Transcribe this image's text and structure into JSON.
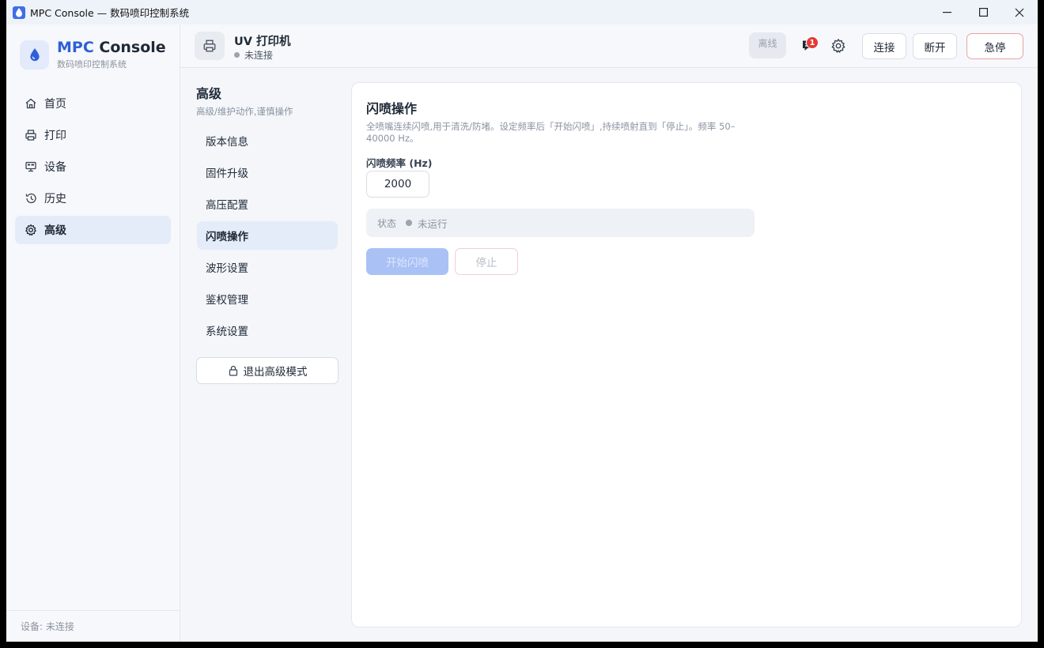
{
  "window": {
    "title": "MPC Console — 数码喷印控制系统",
    "controls": [
      "minimize-icon",
      "maximize-icon",
      "close-icon"
    ]
  },
  "brand": {
    "name_accent": "MPC",
    "name_rest": " Console",
    "subtitle": "数码喷印控制系统",
    "accent_color": "#2f5fd8"
  },
  "sidebar": {
    "items": [
      {
        "label": "首页",
        "icon": "home-icon"
      },
      {
        "label": "打印",
        "icon": "printer-icon"
      },
      {
        "label": "设备",
        "icon": "device-icon"
      },
      {
        "label": "历史",
        "icon": "history-icon"
      },
      {
        "label": "高级",
        "icon": "gear-icon",
        "active": true
      }
    ],
    "footer": "设备: 未连接"
  },
  "header": {
    "device_name": "UV 打印机",
    "device_status": "未连接",
    "offline_badge": "离线",
    "notification_count": "1",
    "connect_label": "连接",
    "disconnect_label": "断开",
    "estop_label": "急停",
    "estop_color": "#e7a3a3"
  },
  "subnav": {
    "title": "高级",
    "desc": "高级/维护动作,谨慎操作",
    "items": [
      {
        "label": "版本信息"
      },
      {
        "label": "固件升级"
      },
      {
        "label": "高压配置"
      },
      {
        "label": "闪喷操作",
        "active": true
      },
      {
        "label": "波形设置"
      },
      {
        "label": "鉴权管理"
      },
      {
        "label": "系统设置"
      }
    ],
    "exit_label": "退出高级模式"
  },
  "main": {
    "title": "闪喷操作",
    "desc": "全喷嘴连续闪喷,用于清洗/防堵。设定频率后「开始闪喷」,持续喷射直到「停止」。频率 50–40000 Hz。",
    "freq_label": "闪喷频率 (Hz)",
    "freq_value": "2000",
    "status_label": "状态",
    "status_value": "未运行",
    "start_label": "开始闪喷",
    "stop_label": "停止"
  }
}
